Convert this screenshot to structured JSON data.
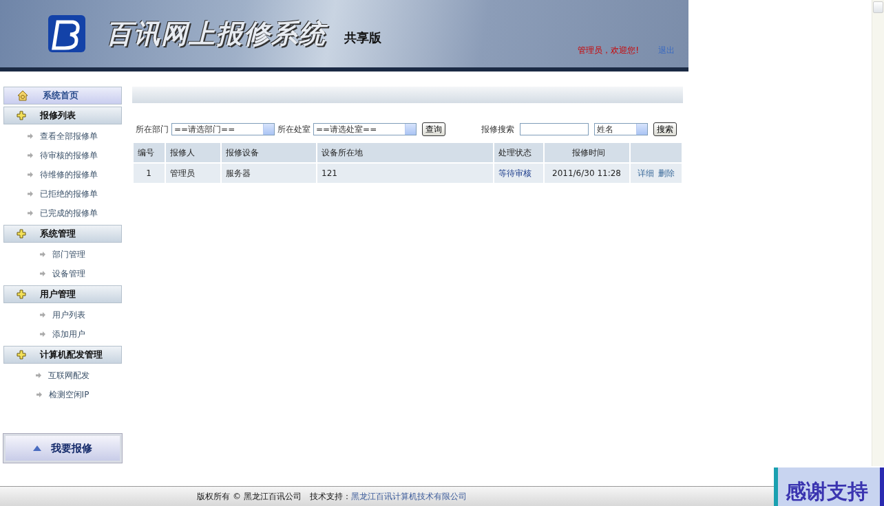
{
  "header": {
    "title": "百讯网上报修系统",
    "edition": "共享版",
    "welcome": "管理员，欢迎您!",
    "logout": "退出"
  },
  "sidebar": {
    "items": [
      {
        "kind": "home",
        "label": "系统首页"
      },
      {
        "kind": "section",
        "label": "报修列表",
        "children": [
          {
            "label": "查看全部报修单"
          },
          {
            "label": "待审核的报修单"
          },
          {
            "label": "待维修的报修单"
          },
          {
            "label": "已拒绝的报修单"
          },
          {
            "label": "已完成的报修单"
          }
        ]
      },
      {
        "kind": "section",
        "label": "系统管理",
        "children": [
          {
            "label": "部门管理"
          },
          {
            "label": "设备管理"
          }
        ]
      },
      {
        "kind": "section",
        "label": "用户管理",
        "children": [
          {
            "label": "用户列表"
          },
          {
            "label": "添加用户"
          }
        ]
      },
      {
        "kind": "section",
        "label": "计算机配发管理",
        "children": [
          {
            "label": "互联网配发"
          },
          {
            "label": "检测空闲IP"
          }
        ]
      }
    ],
    "report_button": "我要报修"
  },
  "filters": {
    "department_label": "所在部门",
    "department_value": "==请选部门==",
    "office_label": "所在处室",
    "office_value": "==请选处室==",
    "query_button": "查询",
    "search_label": "报修搜索",
    "search_field_value": "姓名",
    "search_button": "搜索"
  },
  "table": {
    "columns": [
      "编号",
      "报修人",
      "报修设备",
      "设备所在地",
      "处理状态",
      "报修时间",
      ""
    ],
    "rows": [
      {
        "id": "1",
        "reporter": "管理员",
        "device": "服务器",
        "location": "121",
        "status": "等待审核",
        "time": "2011/6/30 11:28",
        "actions": [
          "详细",
          "删除"
        ]
      }
    ]
  },
  "footer": {
    "copyright": "版权所有 © 黑龙江百讯公司",
    "support_label": "技术支持：",
    "support_link": "黑龙江百讯计算机技术有限公司"
  },
  "banner": {
    "text": "感谢支持"
  }
}
